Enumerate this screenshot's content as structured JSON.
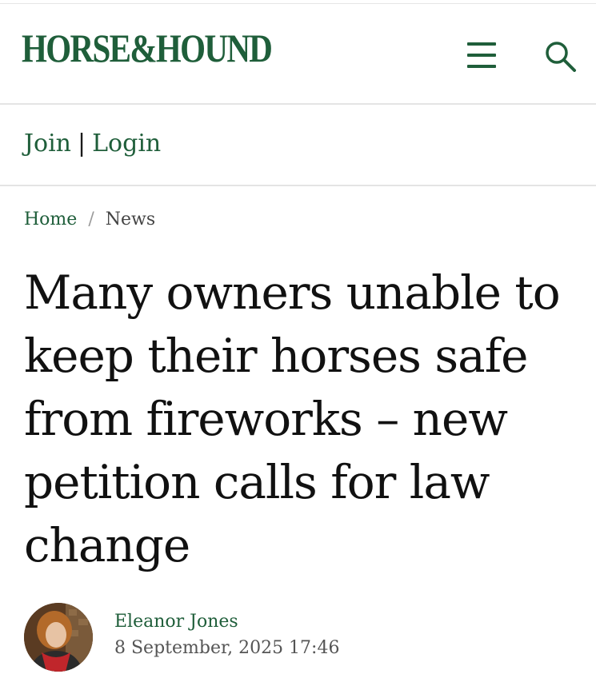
{
  "header": {
    "logo_text": "HORSE&HOUND",
    "menu_icon": "hamburger-menu-icon",
    "search_icon": "search-icon",
    "brand_color": "#1f5e3a"
  },
  "account": {
    "join_label": "Join",
    "separator": "|",
    "login_label": "Login"
  },
  "breadcrumb": {
    "home": "Home",
    "separator": "/",
    "current": "News"
  },
  "article": {
    "headline": "Many owners unable to keep their horses safe from fireworks – new petition calls for law change",
    "author": "Eleanor Jones",
    "date": "8 September, 2025 17:46"
  }
}
